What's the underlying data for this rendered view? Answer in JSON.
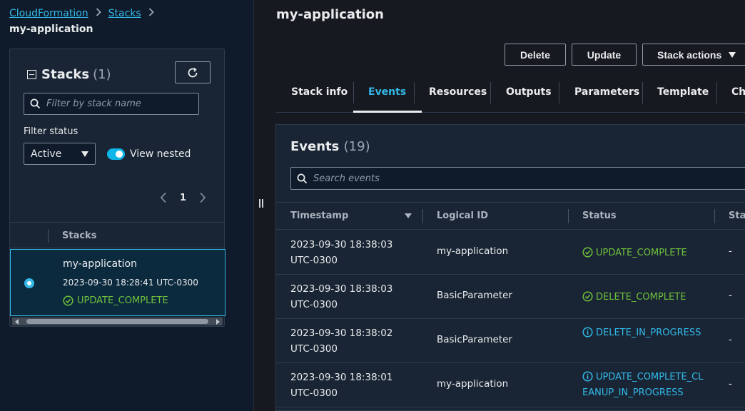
{
  "breadcrumb": {
    "items": [
      "CloudFormation",
      "Stacks"
    ],
    "current": "my-application"
  },
  "stacks_panel": {
    "title": "Stacks",
    "count": "(1)",
    "filter_placeholder": "Filter by stack name",
    "filter_status_label": "Filter status",
    "filter_status_value": "Active",
    "view_nested_label": "View nested",
    "view_nested_on": true,
    "page": "1",
    "column_header": "Stacks",
    "rows": [
      {
        "name": "my-application",
        "date": "2023-09-30 18:28:41 UTC-0300",
        "status": "UPDATE_COMPLETE"
      }
    ]
  },
  "page": {
    "title": "my-application",
    "buttons": {
      "delete": "Delete",
      "update": "Update",
      "stack_actions": "Stack actions"
    },
    "tabs": [
      "Stack info",
      "Events",
      "Resources",
      "Outputs",
      "Parameters",
      "Template",
      "Cha"
    ],
    "active_tab": "Events"
  },
  "events": {
    "title": "Events",
    "count": "(19)",
    "search_placeholder": "Search events",
    "columns": [
      "Timestamp",
      "Logical ID",
      "Status",
      "Sta"
    ],
    "rows": [
      {
        "timestamp": [
          "2023-09-30 18:38:03",
          "UTC-0300"
        ],
        "logical_id": "my-application",
        "status": "UPDATE_COMPLETE",
        "status_kind": "success",
        "reason": "-"
      },
      {
        "timestamp": [
          "2023-09-30 18:38:03",
          "UTC-0300"
        ],
        "logical_id": "BasicParameter",
        "status": "DELETE_COMPLETE",
        "status_kind": "success",
        "reason": "-"
      },
      {
        "timestamp": [
          "2023-09-30 18:38:02",
          "UTC-0300"
        ],
        "logical_id": "BasicParameter",
        "status": "DELETE_IN_PROGRESS",
        "status_kind": "info",
        "reason": "-"
      },
      {
        "timestamp": [
          "2023-09-30 18:38:01",
          "UTC-0300"
        ],
        "logical_id": "my-application",
        "status": "UPDATE_COMPLETE_CLEANUP_IN_PROGRESS",
        "status_kind": "info",
        "reason": "-"
      }
    ]
  },
  "colors": {
    "link": "#33b8e8",
    "success": "#6fc13c",
    "info": "#33b8e8",
    "panel_bg": "#192534",
    "page_bg": "#16191f"
  }
}
